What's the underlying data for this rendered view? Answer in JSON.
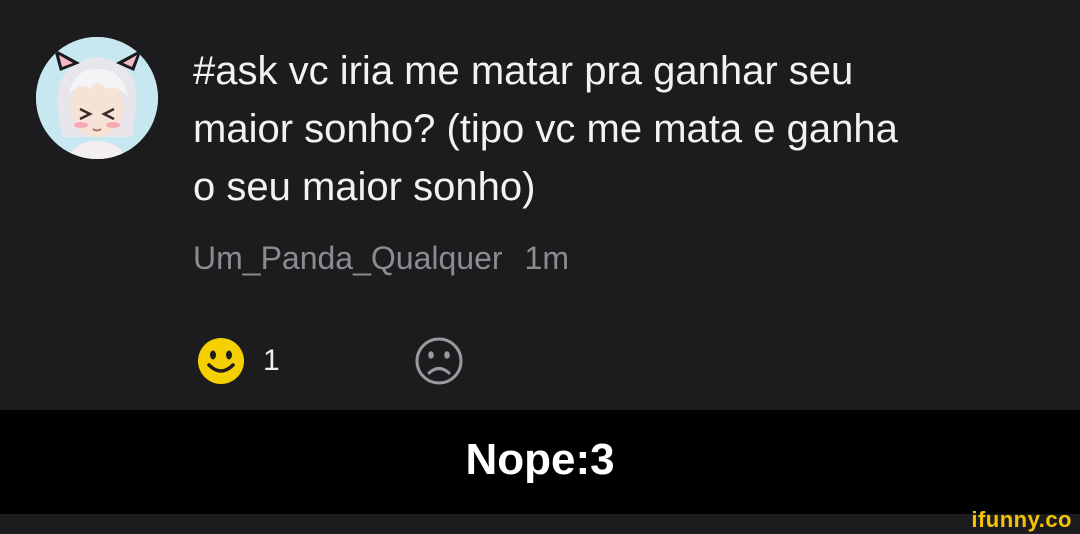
{
  "post": {
    "question": "#ask vc iria me matar pra ganhar seu\nmaior sonho? (tipo vc me mata e ganha\no seu maior sonho)",
    "username": "Um_Panda_Qualquer",
    "time": "1m",
    "avatar_icon": "anime-boy-with-cat-ears-avatar"
  },
  "reactions": {
    "like_icon": "smiley-face-icon",
    "like_count": "1",
    "dislike_icon": "sad-face-icon"
  },
  "caption": "Nope:3",
  "watermark": "ifunny.co",
  "colors": {
    "background": "#1c1c1e",
    "caption_band": "#000000",
    "text_primary": "#f2f2f2",
    "text_secondary": "#8c8c90",
    "smiley": "#f5d000",
    "watermark": "#f5c400"
  }
}
